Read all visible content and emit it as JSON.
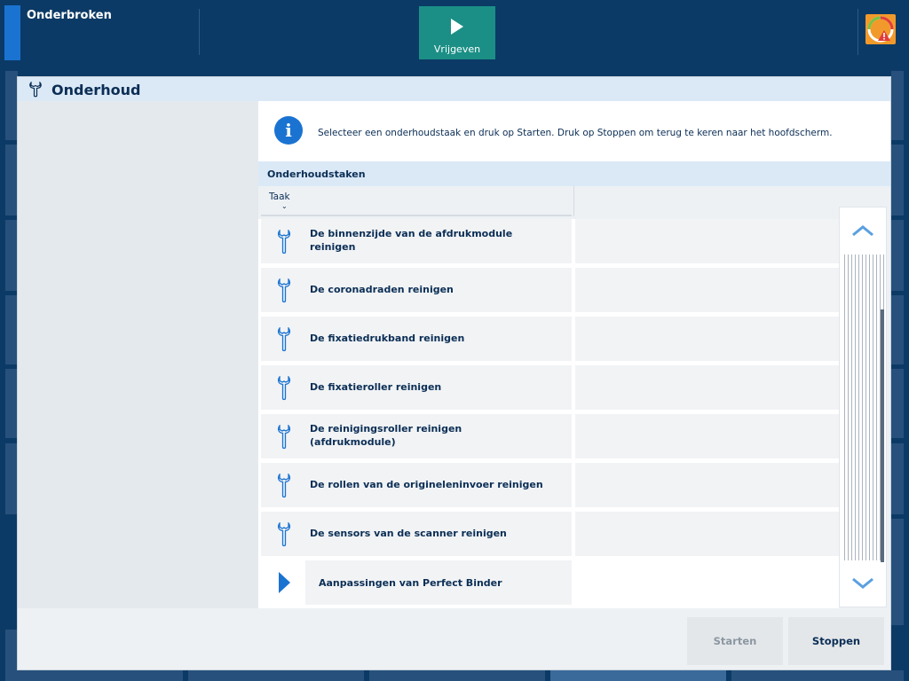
{
  "topbar": {
    "title": "Onderbroken",
    "release_label": "Vrijgeven",
    "icons": {
      "release": "play-icon",
      "status": "status-warning-icon"
    }
  },
  "modal": {
    "title": "Onderhoud",
    "icon": "wrench-icon",
    "info_text": "Selecteer een onderhoudstaak en druk op Starten. Druk op Stoppen om terug te keren naar het hoofdscherm.",
    "section_title": "Onderhoudstaken",
    "column_header": "Taak",
    "tasks": [
      {
        "label_line1": "De binnenzijde van de afdrukmodule",
        "label_line2": "reinigen"
      },
      {
        "label_line1": "De coronadraden reinigen",
        "label_line2": ""
      },
      {
        "label_line1": "De fixatiedrukband reinigen",
        "label_line2": ""
      },
      {
        "label_line1": "De fixatieroller reinigen",
        "label_line2": ""
      },
      {
        "label_line1": "De reinigingsroller reinigen",
        "label_line2": "(afdrukmodule)"
      },
      {
        "label_line1": "De rollen van de origineleninvoer reinigen",
        "label_line2": ""
      },
      {
        "label_line1": "De sensors van de scanner reinigen",
        "label_line2": ""
      }
    ],
    "group": {
      "label": "Aanpassingen van Perfect Binder"
    },
    "buttons": {
      "start": "Starten",
      "stop": "Stoppen"
    },
    "colors": {
      "accent": "#1a73d1",
      "text": "#0b2e55",
      "release": "#1b8f86"
    }
  }
}
